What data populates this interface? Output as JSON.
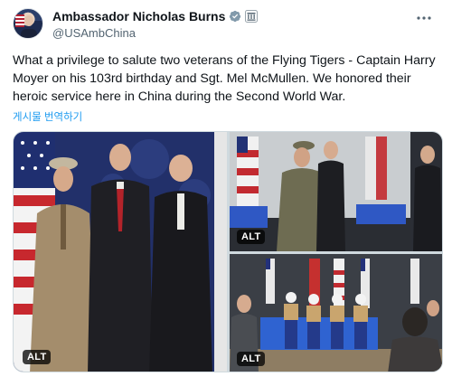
{
  "author": {
    "display_name": "Ambassador Nicholas Burns",
    "handle": "@USAmbChina",
    "verified_icon": "verified-badge-icon",
    "affiliation_icon": "government-flag-icon"
  },
  "tweet": {
    "text": "What a privilege to salute two veterans of the Flying Tigers - Captain Harry Moyer on his 103rd birthday and Sgt. Mel McMullen. We honored their heroic service here in China during the Second World War.",
    "translate_label": "게시물 번역하기"
  },
  "media": {
    "alt_labels": [
      "ALT",
      "ALT",
      "ALT"
    ]
  },
  "colors": {
    "link": "#1d9bf0",
    "verified": "#1d9bf0",
    "secondary_text": "#536471"
  }
}
